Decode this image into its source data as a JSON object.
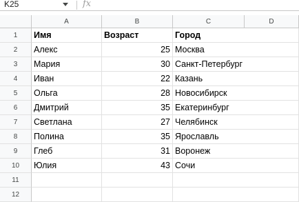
{
  "formula_bar": {
    "name_box": "K25",
    "fx_symbol": "fx",
    "formula_value": ""
  },
  "columns": [
    "A",
    "B",
    "C",
    "D"
  ],
  "rows": [
    {
      "num": "1",
      "cells": [
        "Имя",
        "Возраст",
        "Город"
      ]
    },
    {
      "num": "2",
      "cells": [
        "Алекс",
        "25",
        "Москва"
      ]
    },
    {
      "num": "3",
      "cells": [
        "Мария",
        "30",
        "Санкт-Петербург"
      ]
    },
    {
      "num": "4",
      "cells": [
        "Иван",
        "22",
        "Казань"
      ]
    },
    {
      "num": "5",
      "cells": [
        "Ольга",
        "28",
        "Новосибирск"
      ]
    },
    {
      "num": "6",
      "cells": [
        "Дмитрий",
        "35",
        "Екатеринбург"
      ]
    },
    {
      "num": "7",
      "cells": [
        "Светлана",
        "27",
        "Челябинск"
      ]
    },
    {
      "num": "8",
      "cells": [
        "Полина",
        "35",
        "Ярославль"
      ]
    },
    {
      "num": "9",
      "cells": [
        "Глеб",
        "31",
        "Воронеж"
      ]
    },
    {
      "num": "10",
      "cells": [
        "Юлия",
        "43",
        "Сочи"
      ]
    },
    {
      "num": "11",
      "cells": [
        "",
        "",
        ""
      ]
    },
    {
      "num": "12",
      "cells": [
        "",
        "",
        ""
      ]
    }
  ],
  "colors": {
    "header_bg": "#f8f9fa",
    "gridline": "#e1e1e1",
    "header_border": "#c7c7c7",
    "text": "#000000"
  }
}
